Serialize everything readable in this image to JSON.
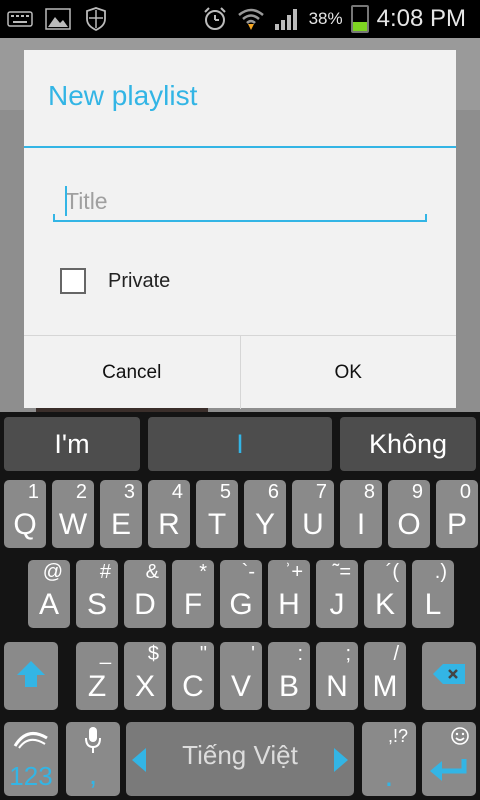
{
  "status_bar": {
    "battery_percent": "38%",
    "time": "4:08 PM",
    "icons": [
      "keyboard-icon",
      "image-icon",
      "shield-icon",
      "alarm-icon",
      "wifi-icon",
      "signal-icon",
      "battery-icon"
    ]
  },
  "dialog": {
    "title": "New playlist",
    "title_placeholder": "Title",
    "title_value": "",
    "private_label": "Private",
    "private_checked": false,
    "cancel_label": "Cancel",
    "ok_label": "OK"
  },
  "keyboard": {
    "suggestions": [
      "I'm",
      "I",
      "Không"
    ],
    "row1": [
      {
        "main": "Q",
        "hint": "1"
      },
      {
        "main": "W",
        "hint": "2"
      },
      {
        "main": "E",
        "hint": "3"
      },
      {
        "main": "R",
        "hint": "4"
      },
      {
        "main": "T",
        "hint": "5"
      },
      {
        "main": "Y",
        "hint": "6"
      },
      {
        "main": "U",
        "hint": "7"
      },
      {
        "main": "I",
        "hint": "8"
      },
      {
        "main": "O",
        "hint": "9"
      },
      {
        "main": "P",
        "hint": "0"
      }
    ],
    "row2": [
      {
        "main": "A",
        "hint": "@"
      },
      {
        "main": "S",
        "hint": "#"
      },
      {
        "main": "D",
        "hint": "&"
      },
      {
        "main": "F",
        "hint": "*"
      },
      {
        "main": "G",
        "hint": "`-"
      },
      {
        "main": "H",
        "hint": "ʾ+"
      },
      {
        "main": "J",
        "hint": "˜="
      },
      {
        "main": "K",
        "hint": "´("
      },
      {
        "main": "L",
        "hint": ".)"
      }
    ],
    "row3": [
      {
        "main": "Z",
        "hint": "_"
      },
      {
        "main": "X",
        "hint": "$"
      },
      {
        "main": "C",
        "hint": "\""
      },
      {
        "main": "V",
        "hint": "'"
      },
      {
        "main": "B",
        "hint": ":"
      },
      {
        "main": "N",
        "hint": ";"
      },
      {
        "main": "M",
        "hint": "/"
      }
    ],
    "numbers_label": "123",
    "comma_label": ",",
    "space_label": "Tiếng Việt",
    "period_hint": ",!?",
    "period_label": ".",
    "accent_color": "#33b5e5"
  }
}
